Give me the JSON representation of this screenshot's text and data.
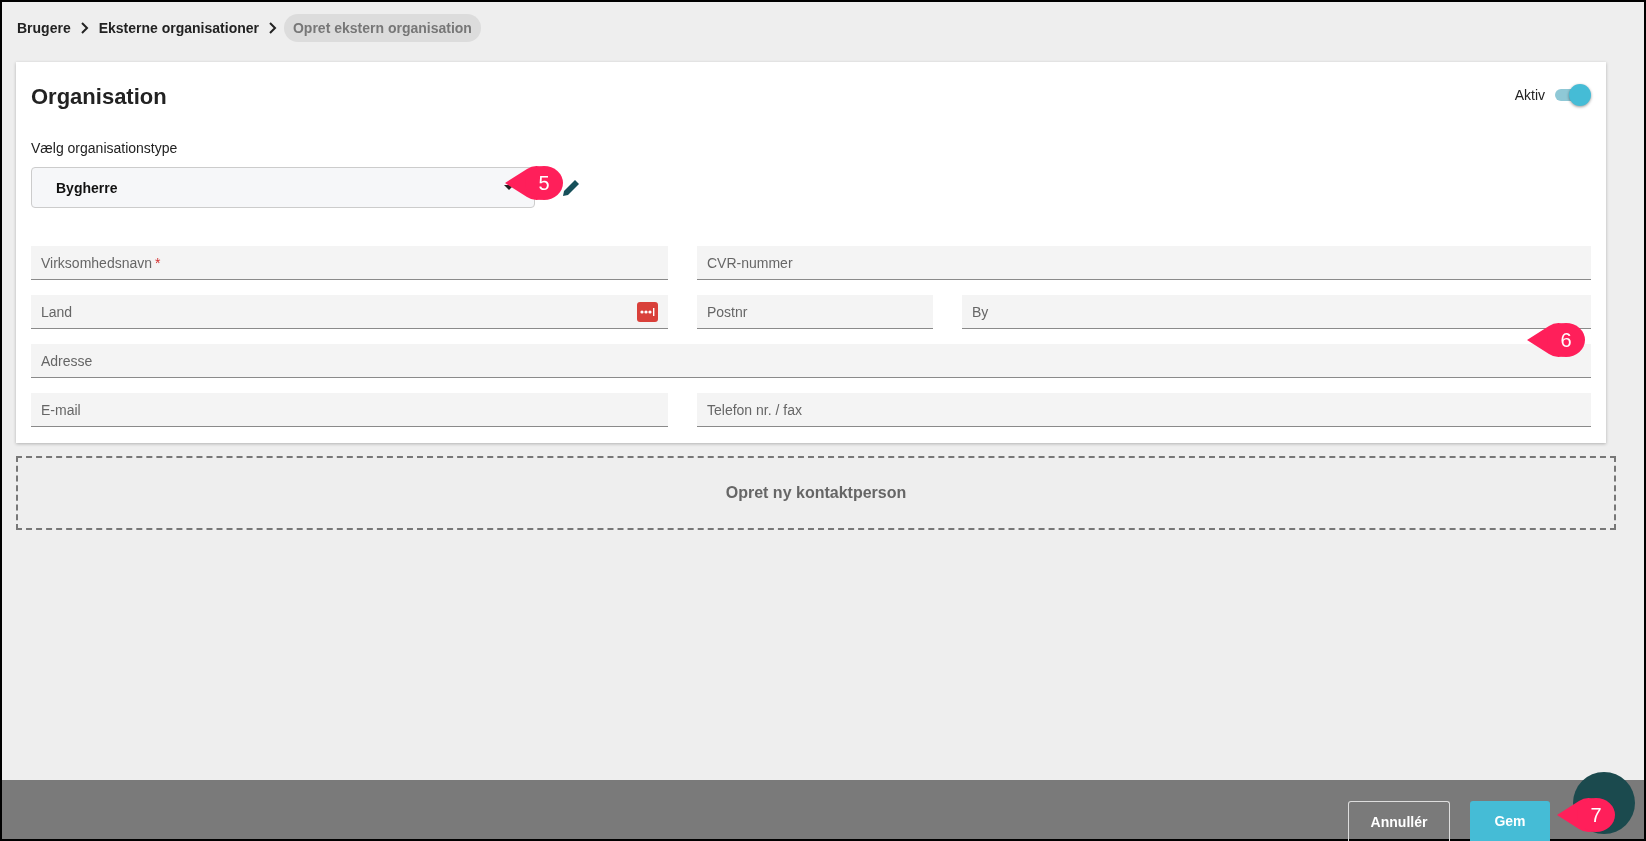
{
  "breadcrumb": [
    {
      "label": "Brugere",
      "current": false
    },
    {
      "label": "Eksterne organisationer",
      "current": false
    },
    {
      "label": "Opret ekstern organisation",
      "current": true
    }
  ],
  "card": {
    "title": "Organisation",
    "active_toggle": {
      "label": "Aktiv",
      "on": true
    },
    "type_select": {
      "label": "Vælg organisationstype",
      "value": "Bygherre"
    },
    "field_rows": [
      [
        {
          "placeholder": "Virksomhedsnavn",
          "required_mark": "*",
          "kind": "text"
        },
        {
          "placeholder": "CVR-nummer",
          "kind": "text"
        }
      ],
      [
        {
          "placeholder": "Land",
          "kind": "autofill"
        },
        {
          "placeholder": "Postnr",
          "kind": "text"
        },
        {
          "placeholder": "By",
          "kind": "text"
        }
      ],
      [
        {
          "placeholder": "Adresse",
          "kind": "text"
        }
      ],
      [
        {
          "placeholder": "E-mail",
          "kind": "text"
        },
        {
          "placeholder": "Telefon nr. / fax",
          "kind": "text"
        }
      ]
    ]
  },
  "add_contact": {
    "label": "Opret ny kontaktperson"
  },
  "footer": {
    "buttons": [
      {
        "label": "Annullér",
        "kind": "secondary"
      },
      {
        "label": "Gem",
        "kind": "primary"
      }
    ]
  },
  "callouts": [
    "5",
    "6",
    "7"
  ]
}
